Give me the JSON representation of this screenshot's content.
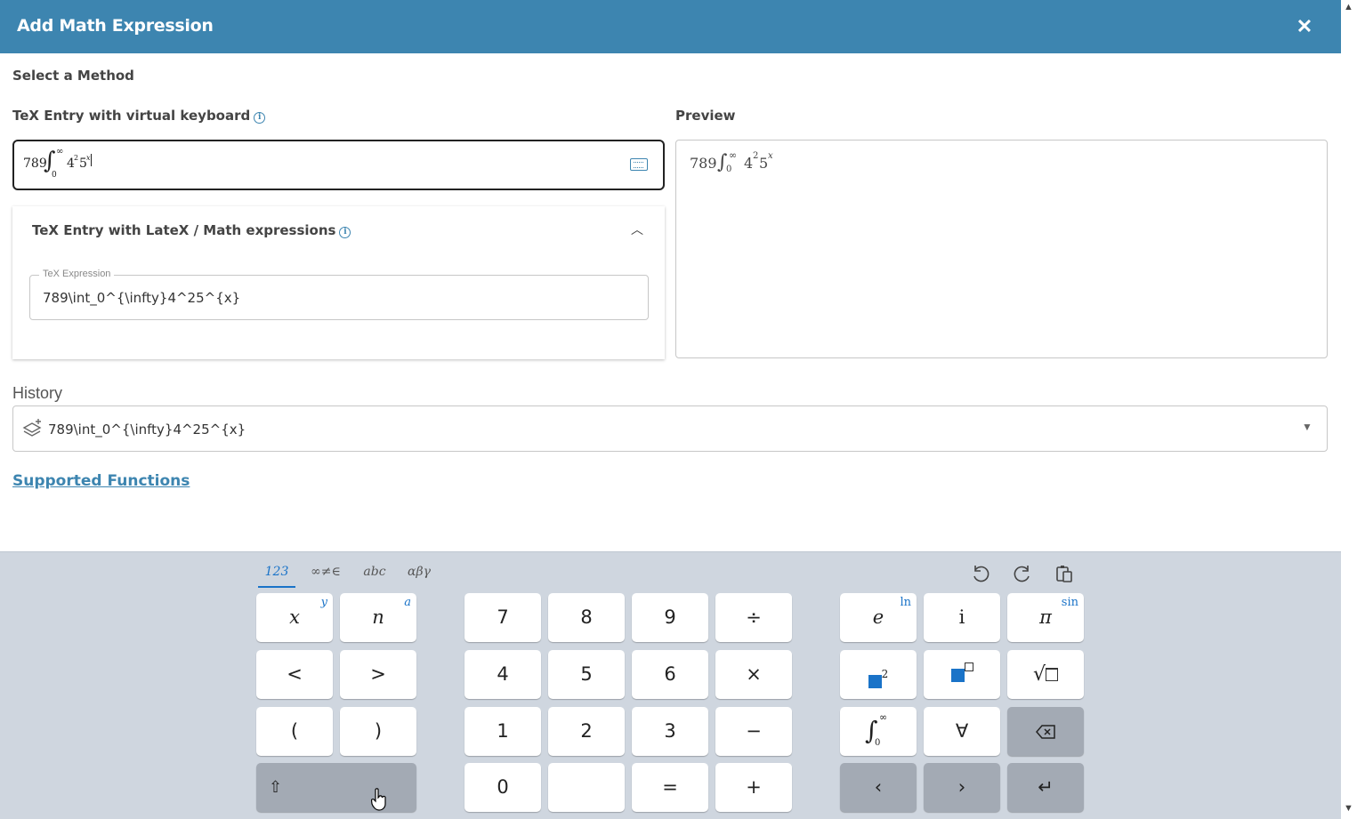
{
  "dialog": {
    "title": "Add Math Expression"
  },
  "method": {
    "heading": "Select a Method",
    "virtual_keyboard_label": "TeX Entry with virtual keyboard",
    "mathfield": {
      "number": "789",
      "int_upper": "∞",
      "int_lower": "0",
      "base1": "4",
      "exp1": "2",
      "base2": "5",
      "exp2": "x"
    },
    "latex_panel_label": "TeX Entry with LateX / Math expressions",
    "tex_expression_legend": "TeX Expression",
    "tex_expression_value": "789\\int_0^{\\infty}4^25^{x}"
  },
  "preview": {
    "label": "Preview",
    "number": "789",
    "int_upper": "∞",
    "int_lower": "0",
    "base1": "4",
    "exp1": "2",
    "base2": "5",
    "exp2": "x"
  },
  "history": {
    "label": "History",
    "value": "789\\int_0^{\\infty}4^25^{x}"
  },
  "supported_functions_link": "Supported Functions",
  "keyboard": {
    "tabs": [
      "123",
      "∞≠∈",
      "abc",
      "αβγ"
    ],
    "active_tab": "123",
    "keys": {
      "x": "x",
      "x_shift": "y",
      "n": "n",
      "n_shift": "a",
      "lt": "<",
      "gt": ">",
      "lparen": "(",
      "rparen": ")",
      "k7": "7",
      "k8": "8",
      "k9": "9",
      "div": "÷",
      "k4": "4",
      "k5": "5",
      "k6": "6",
      "times": "×",
      "k1": "1",
      "k2": "2",
      "k3": "3",
      "minus": "−",
      "k0": "0",
      "eq": "=",
      "plus": "+",
      "e": "e",
      "e_shift": "ln",
      "i": "i",
      "pi": "π",
      "pi_shift": "sin",
      "square_exp": "2",
      "int_upper": "∞",
      "int_lower": "0",
      "forall": "∀"
    }
  }
}
